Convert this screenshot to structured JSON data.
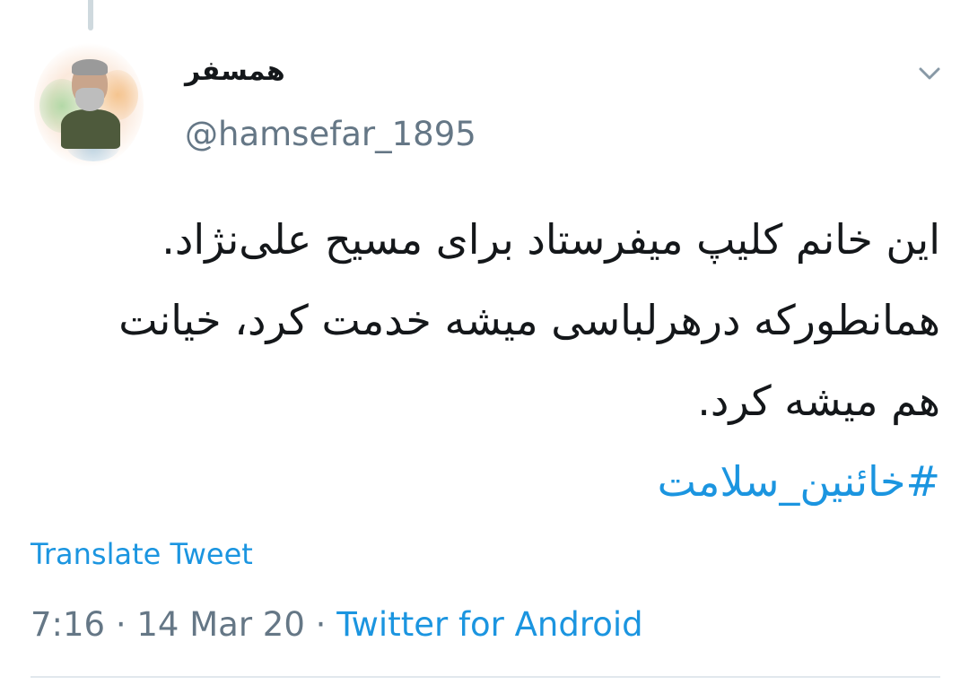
{
  "tweet": {
    "author": {
      "display_name": "همسفر",
      "handle": "@hamsefar_1895"
    },
    "text_lines": [
      "این خانم کلیپ میفرستاد برای مسیح علی‌نژاد.",
      "همانطورکه درهرلباسی میشه خدمت کرد، خیانت",
      "هم میشه کرد."
    ],
    "hashtag": "#خائنین_سلامت",
    "translate_label": "Translate Tweet",
    "time": "7:16",
    "separator": "·",
    "date": "14 Mar 20",
    "source": "Twitter for Android"
  },
  "icons": {
    "menu": "chevron-down-icon",
    "avatar": "profile-photo"
  },
  "colors": {
    "link": "#1b95e0",
    "secondary_text": "#657786",
    "primary_text": "#14171a",
    "divider": "#e1e8ed"
  }
}
